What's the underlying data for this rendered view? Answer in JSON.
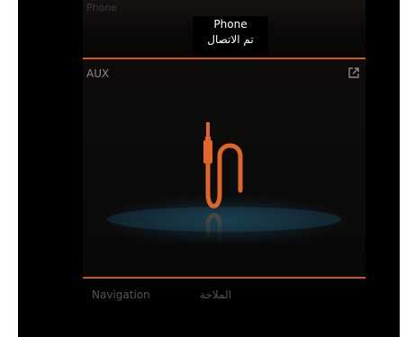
{
  "phone_card": {
    "label": "Phone",
    "toast_title": "Phone",
    "toast_status": "تم الاتصال"
  },
  "aux_card": {
    "label": "AUX",
    "icon": "external-link-icon"
  },
  "navigation_card": {
    "label": "Navigation",
    "sub_label": "الملاحة"
  },
  "colors": {
    "accent": "#c85a18",
    "cable": "#e0652b",
    "glow": "#2878a0"
  }
}
